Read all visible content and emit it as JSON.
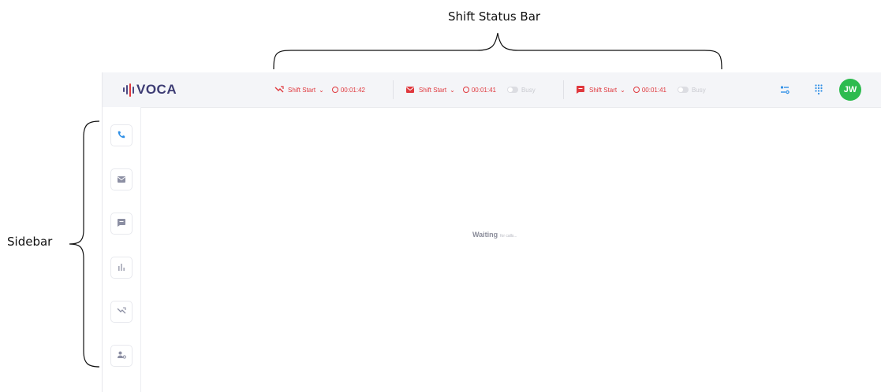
{
  "annotations": {
    "top_label": "Shift Status Bar",
    "side_label": "Sidebar"
  },
  "app": {
    "logo_text": "VOCA",
    "shifts": [
      {
        "channel_icon": "call-end-icon",
        "label": "Shift Start",
        "timer": "00:01:42",
        "show_busy": false
      },
      {
        "channel_icon": "email-icon",
        "label": "Shift Start",
        "timer": "00:01:41",
        "show_busy": true,
        "busy_label": "Busy"
      },
      {
        "channel_icon": "chat-icon",
        "label": "Shift Start",
        "timer": "00:01:41",
        "show_busy": true,
        "busy_label": "Busy"
      }
    ],
    "right_icons": [
      "settings-toggle-icon",
      "dialpad-icon"
    ],
    "avatar_initials": "JW",
    "sidebar_items": [
      "phone-icon",
      "email-icon",
      "chat-icon",
      "bar-chart-icon",
      "call-end-icon",
      "user-settings-icon"
    ],
    "main": {
      "status_primary": "Waiting",
      "status_secondary": "for calls..."
    },
    "colors": {
      "accent_red": "#e0393e",
      "brand_purple": "#3d3c74",
      "avatar_green": "#2dbb4f",
      "icon_blue": "#2f8fe6",
      "icon_gray": "#8c8fa3"
    }
  }
}
